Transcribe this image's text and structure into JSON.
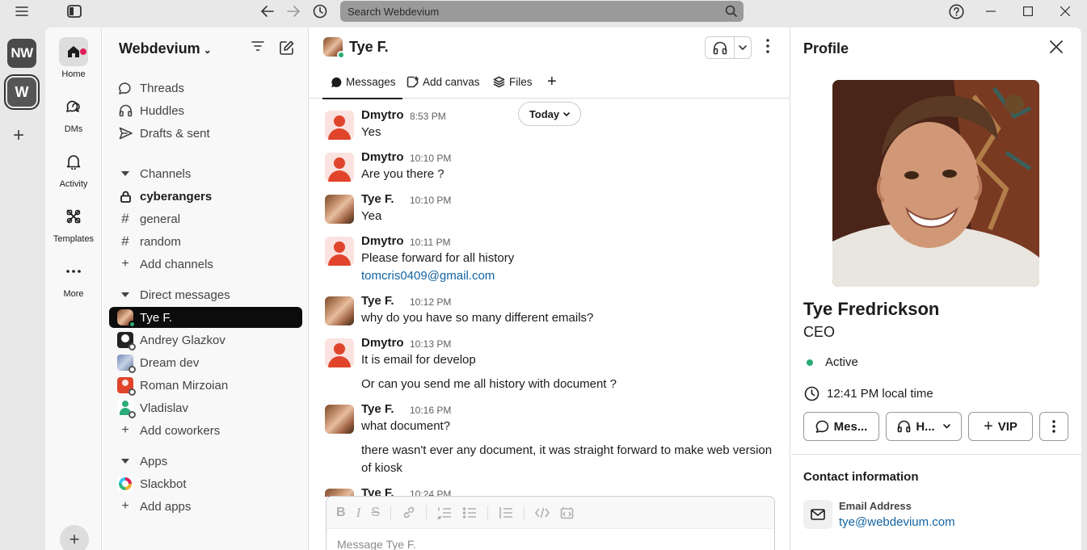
{
  "topbar": {
    "search_placeholder": "Search Webdevium"
  },
  "workspaces": [
    {
      "initials": "NW"
    },
    {
      "initials": "W"
    }
  ],
  "nav": {
    "home": "Home",
    "dms": "DMs",
    "activity": "Activity",
    "templates": "Templates",
    "more": "More"
  },
  "sidebar": {
    "workspace_name": "Webdevium",
    "top_items": [
      "Threads",
      "Huddles",
      "Drafts & sent"
    ],
    "channels_header": "Channels",
    "channels": [
      {
        "name": "cyberangers",
        "type": "private",
        "bold": true
      },
      {
        "name": "general",
        "type": "public"
      },
      {
        "name": "random",
        "type": "public"
      }
    ],
    "add_channels": "Add channels",
    "dm_header": "Direct messages",
    "dms": [
      "Tye F.",
      "Andrey Glazkov",
      "Dream dev",
      "Roman Mirzoian",
      "Vladislav"
    ],
    "add_coworkers": "Add coworkers",
    "apps_header": "Apps",
    "apps": [
      "Slackbot"
    ],
    "add_apps": "Add apps"
  },
  "chat": {
    "title": "Tye F.",
    "tabs": [
      "Messages",
      "Add canvas",
      "Files"
    ],
    "date_pill": "Today",
    "messages": [
      {
        "author": "Dmytro",
        "time": "8:53 PM",
        "lines": [
          "Yes"
        ]
      },
      {
        "author": "Dmytro",
        "time": "10:10 PM",
        "lines": [
          "Are you there ?"
        ]
      },
      {
        "author": "Tye F.",
        "time": "10:10 PM",
        "lines": [
          "Yea"
        ]
      },
      {
        "author": "Dmytro",
        "time": "10:11 PM",
        "lines": [
          "Please forward for all history"
        ],
        "link": "tomcris0409@gmail.com"
      },
      {
        "author": "Tye F.",
        "time": "10:12 PM",
        "lines": [
          "why do you have so many different emails?"
        ]
      },
      {
        "author": "Dmytro",
        "time": "10:13 PM",
        "lines": [
          "It is email for develop",
          "Or can you send me all history with document ?"
        ]
      },
      {
        "author": "Tye F.",
        "time": "10:16 PM",
        "lines": [
          "what document?",
          "there wasn't ever any document, it was straight forward to make web version of kiosk"
        ]
      },
      {
        "author": "Tye F.",
        "time": "10:24 PM",
        "lines": []
      }
    ],
    "composer_placeholder": "Message Tye F."
  },
  "profile": {
    "title": "Profile",
    "name": "Tye Fredrickson",
    "role": "CEO",
    "status": "Active",
    "local_time": "12:41 PM local time",
    "buttons": {
      "message": "Mes...",
      "huddle": "H...",
      "vip": "VIP"
    },
    "contact_header": "Contact information",
    "email_label": "Email Address",
    "email": "tye@webdevium.com"
  },
  "colors": {
    "accent_link": "#1264a3",
    "active_green": "#2bac76",
    "notification": "#e01e5a"
  }
}
